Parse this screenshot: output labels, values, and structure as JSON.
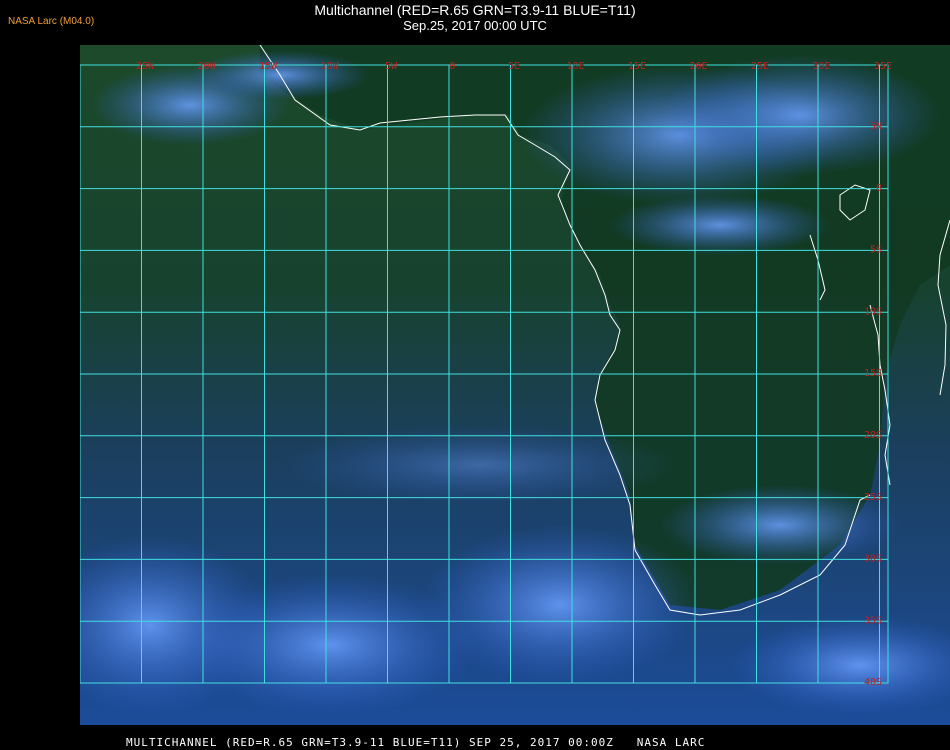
{
  "header": {
    "source_label": "NASA Larc (M04.0)",
    "title": "Multichannel (RED=R.65 GRN=T3.9-11 BLUE=T11)",
    "subtitle": "Sep.25, 2017 00:00 UTC"
  },
  "footer": {
    "text": "MULTICHANNEL (RED=R.65 GRN=T3.9-11 BLUE=T11) SEP 25, 2017 00:00Z   NASA LARC"
  },
  "map": {
    "grid_color": "#40e0e0",
    "coast_color": "#ffffff",
    "ocean_color": "#1a3a6a",
    "land_color": "#123a1a",
    "lon_labels": [
      "25W",
      "20W",
      "15W",
      "10W",
      "5W",
      "0",
      "5E",
      "10E",
      "15E",
      "20E",
      "25E",
      "30E",
      "35E"
    ],
    "lat_labels": [
      "5N",
      "0",
      "5S",
      "10S",
      "15S",
      "20S",
      "25S",
      "30S",
      "35S",
      "40S"
    ]
  }
}
